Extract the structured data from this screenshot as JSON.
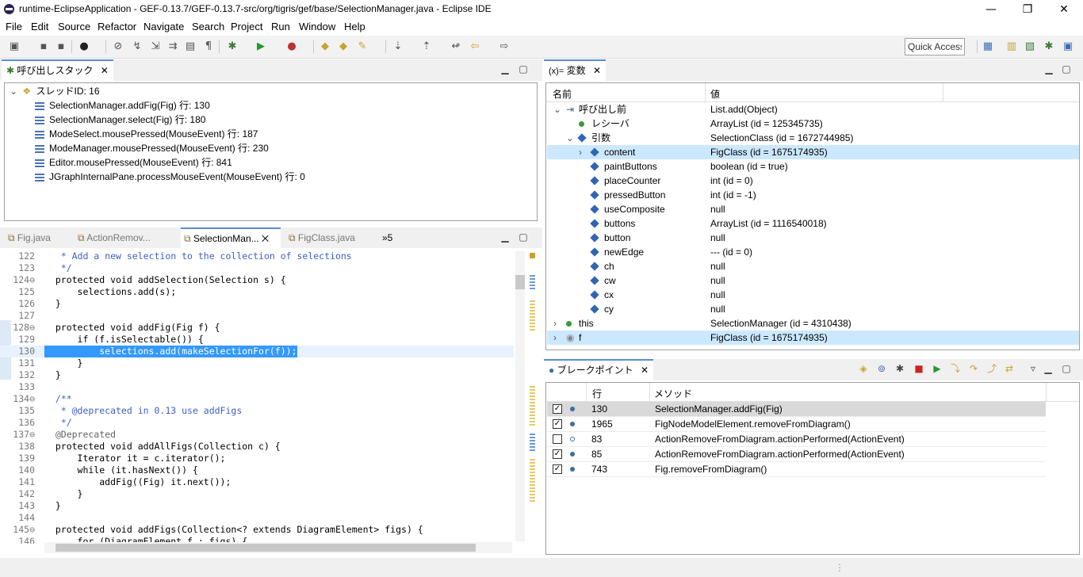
{
  "window": {
    "title": "runtime-EclipseApplication - GEF-0.13.7/GEF-0.13.7-src/org/tigris/gef/base/SelectionManager.java - Eclipse IDE",
    "minimize": "—",
    "restore": "❐",
    "close": "✕"
  },
  "menu": [
    "File",
    "Edit",
    "Source",
    "Refactor",
    "Navigate",
    "Search",
    "Project",
    "Run",
    "Window",
    "Help"
  ],
  "toolbar": {
    "quick_access": "Quick Access"
  },
  "callstack": {
    "tab_label": "呼び出しスタック",
    "thread": "スレッドID: 16",
    "frames": [
      "SelectionManager.addFig(Fig) 行: 130",
      "SelectionManager.select(Fig) 行: 180",
      "ModeSelect.mousePressed(MouseEvent) 行: 187",
      "ModeManager.mousePressed(MouseEvent) 行: 230",
      "Editor.mousePressed(MouseEvent) 行: 841",
      "JGraphInternalPane.processMouseEvent(MouseEvent) 行: 0"
    ]
  },
  "editor": {
    "tabs": [
      "Fig.java",
      "ActionRemov...",
      "SelectionMan...",
      "FigClass.java"
    ],
    "overflow": "»5",
    "current_line": 130,
    "lines": [
      {
        "n": "122",
        "t": "   * Add a new selection to the collection of selections"
      },
      {
        "n": "123",
        "t": "   */"
      },
      {
        "n": "124⊖",
        "t": "  protected void addSelection(Selection s) {"
      },
      {
        "n": "125",
        "t": "      selections.add(s);"
      },
      {
        "n": "126",
        "t": "  }"
      },
      {
        "n": "127",
        "t": ""
      },
      {
        "n": "128⊖",
        "t": "  protected void addFig(Fig f) {"
      },
      {
        "n": "129",
        "t": "      if (f.isSelectable()) {"
      },
      {
        "n": "130",
        "t": "          selections.add(makeSelectionFor(f));"
      },
      {
        "n": "131",
        "t": "      }"
      },
      {
        "n": "132",
        "t": "  }"
      },
      {
        "n": "133",
        "t": ""
      },
      {
        "n": "134⊖",
        "t": "  /**"
      },
      {
        "n": "135",
        "t": "   * @deprecated in 0.13 use addFigs"
      },
      {
        "n": "136",
        "t": "   */"
      },
      {
        "n": "137⊖",
        "t": "  @Deprecated"
      },
      {
        "n": "138",
        "t": "  protected void addAllFigs(Collection c) {"
      },
      {
        "n": "139",
        "t": "      Iterator it = c.iterator();"
      },
      {
        "n": "140",
        "t": "      while (it.hasNext()) {"
      },
      {
        "n": "141",
        "t": "          addFig((Fig) it.next());"
      },
      {
        "n": "142",
        "t": "      }"
      },
      {
        "n": "143",
        "t": "  }"
      },
      {
        "n": "144",
        "t": ""
      },
      {
        "n": "145⊖",
        "t": "  protected void addFigs(Collection<? extends DiagramElement> figs) {"
      },
      {
        "n": "146",
        "t": "      for (DiagramElement f : figs) {"
      }
    ]
  },
  "variables": {
    "tab_label": "変数",
    "tab_prefix": "(x)=",
    "col_name": "名前",
    "col_value": "値",
    "rows": [
      {
        "name": "呼び出し前",
        "value": "List.add(Object)"
      },
      {
        "name": "レシーバ",
        "value": "ArrayList (id = 125345735)"
      },
      {
        "name": "引数",
        "value": "SelectionClass (id = 1672744985)"
      },
      {
        "name": "content",
        "value": "FigClass (id = 1675174935)"
      },
      {
        "name": "paintButtons",
        "value": "boolean (id = true)"
      },
      {
        "name": "placeCounter",
        "value": "int (id = 0)"
      },
      {
        "name": "pressedButton",
        "value": "int (id = -1)"
      },
      {
        "name": "useComposite",
        "value": "null"
      },
      {
        "name": "buttons",
        "value": "ArrayList (id = 1116540018)"
      },
      {
        "name": "button",
        "value": "null"
      },
      {
        "name": "newEdge",
        "value": "--- (id = 0)"
      },
      {
        "name": "ch",
        "value": "null"
      },
      {
        "name": "cw",
        "value": "null"
      },
      {
        "name": "cx",
        "value": "null"
      },
      {
        "name": "cy",
        "value": "null"
      },
      {
        "name": "this",
        "value": "SelectionManager (id = 4310438)"
      },
      {
        "name": "f",
        "value": "FigClass (id = 1675174935)"
      }
    ]
  },
  "breakpoints": {
    "tab_label": "ブレークポイント",
    "col_line": "行",
    "col_method": "メソッド",
    "rows": [
      {
        "line": "130",
        "method": "SelectionManager.addFig(Fig)",
        "checked": true
      },
      {
        "line": "1965",
        "method": "FigNodeModelElement.removeFromDiagram()",
        "checked": true
      },
      {
        "line": "83",
        "method": "ActionRemoveFromDiagram.actionPerformed(ActionEvent)",
        "checked": false
      },
      {
        "line": "85",
        "method": "ActionRemoveFromDiagram.actionPerformed(ActionEvent)",
        "checked": true
      },
      {
        "line": "743",
        "method": "Fig.removeFromDiagram()",
        "checked": true
      }
    ]
  },
  "colors": {
    "selection": "#cce8ff",
    "current_line": "#3399ff",
    "keyword": "#7f0055",
    "comment": "#3f5fbf"
  }
}
